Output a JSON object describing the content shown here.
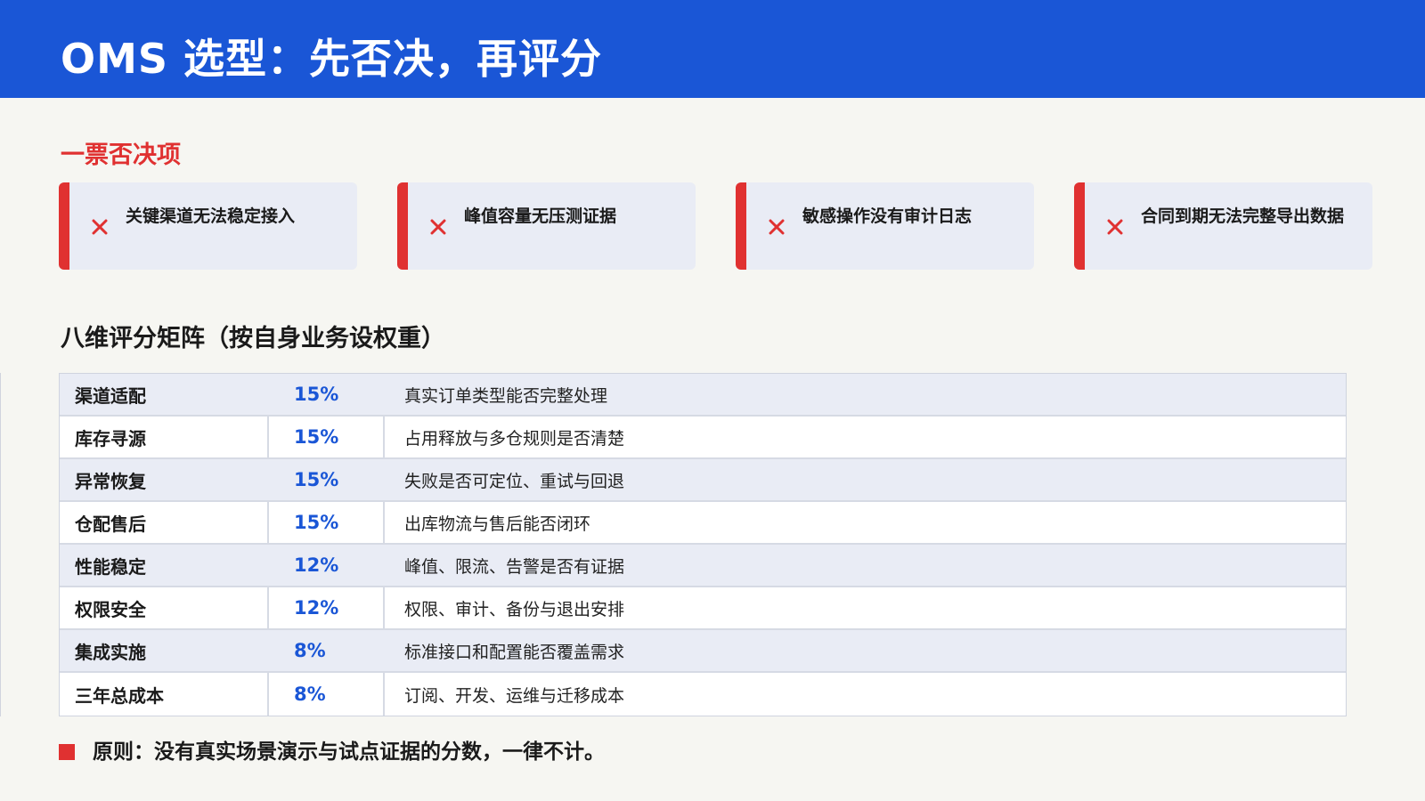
{
  "header": {
    "title": "OMS 选型：先否决，再评分"
  },
  "veto": {
    "heading": "一票否决项",
    "accent_color": "#e03131",
    "items": [
      {
        "label": "关键渠道无法稳定接入",
        "icon": "x-icon"
      },
      {
        "label": "峰值容量无压测证据",
        "icon": "x-icon"
      },
      {
        "label": "敏感操作没有审计日志",
        "icon": "x-icon"
      },
      {
        "label": "合同到期无法完整导出数据",
        "icon": "x-icon"
      }
    ]
  },
  "matrix": {
    "heading": "八维评分矩阵（按自身业务设权重）",
    "weight_color": "#1a56d6",
    "rows": [
      {
        "dimension": "渠道适配",
        "weight": "15%",
        "description": "真实订单类型能否完整处理"
      },
      {
        "dimension": "库存寻源",
        "weight": "15%",
        "description": "占用释放与多仓规则是否清楚"
      },
      {
        "dimension": "异常恢复",
        "weight": "15%",
        "description": "失败是否可定位、重试与回退"
      },
      {
        "dimension": "仓配售后",
        "weight": "15%",
        "description": "出库物流与售后能否闭环"
      },
      {
        "dimension": "性能稳定",
        "weight": "12%",
        "description": "峰值、限流、告警是否有证据"
      },
      {
        "dimension": "权限安全",
        "weight": "12%",
        "description": "权限、审计、备份与退出安排"
      },
      {
        "dimension": "集成实施",
        "weight": "8%",
        "description": "标准接口和配置能否覆盖需求"
      },
      {
        "dimension": "三年总成本",
        "weight": "8%",
        "description": "订阅、开发、运维与迁移成本"
      }
    ]
  },
  "principle": {
    "text": "原则：没有真实场景演示与试点证据的分数，一律不计。"
  },
  "colors": {
    "header_bg": "#1a56d6",
    "page_bg": "#f6f6f2",
    "card_bg": "#e9ecf5"
  }
}
